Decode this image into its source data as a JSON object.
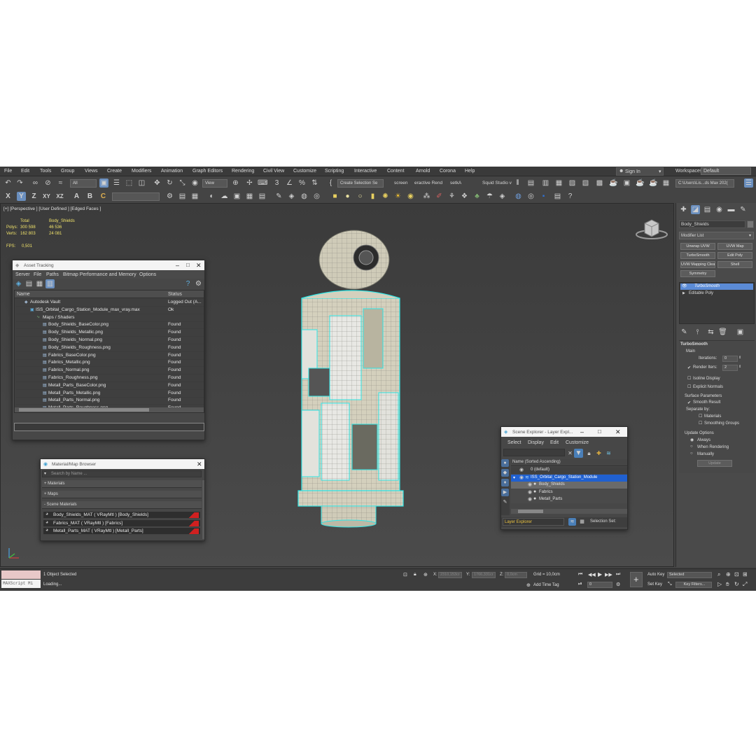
{
  "menu": [
    "File",
    "Edit",
    "Tools",
    "Group",
    "Views",
    "Create",
    "Modifiers",
    "Animation",
    "Graph Editors",
    "Rendering",
    "Civil View",
    "Customize",
    "Scripting",
    "Interactive",
    "Content",
    "Arnold",
    "Corona",
    "Help"
  ],
  "signin": "Sign In",
  "workspaces": {
    "label": "Workspaces:",
    "value": "Default"
  },
  "toolbar": {
    "filter": "All",
    "view": "View",
    "selection_set": "Create Selection Se",
    "screen": "screen",
    "interactive": "eractive Rend",
    "setka": "setkA",
    "squid": "Squid Studio v",
    "path": "C:\\Users\\Lis...ds Max 202("
  },
  "viewport": {
    "label": "[+] [Perspective ] [User Defined ] [Edged Faces ]",
    "stats": {
      "total": "Total",
      "object": "Body_Shields",
      "polys_label": "Polys:",
      "polys_total": "300 598",
      "polys_obj": "46 536",
      "verts_label": "Verts:",
      "verts_total": "162 803",
      "verts_obj": "24 081",
      "fps_label": "FPS:",
      "fps": "0,501"
    }
  },
  "asset_tracking": {
    "title": "Asset Tracking",
    "menu": [
      "Server",
      "File",
      "Paths",
      "Bitmap Performance and Memory",
      "Options"
    ],
    "col_name": "Name",
    "col_status": "Status",
    "rows": [
      {
        "name": "Autodesk Vault",
        "status": "Logged Out (A..."
      },
      {
        "name": "ISS_Orbital_Cargo_Station_Module_max_vray.max",
        "status": "Ok"
      },
      {
        "name": "Maps / Shaders",
        "status": ""
      },
      {
        "name": "Body_Shields_BaseColor.png",
        "status": "Found"
      },
      {
        "name": "Body_Shields_Metallic.png",
        "status": "Found"
      },
      {
        "name": "Body_Shields_Normal.png",
        "status": "Found"
      },
      {
        "name": "Body_Shields_Roughness.png",
        "status": "Found"
      },
      {
        "name": "Fabrics_BaseColor.png",
        "status": "Found"
      },
      {
        "name": "Fabrics_Metallic.png",
        "status": "Found"
      },
      {
        "name": "Fabrics_Normal.png",
        "status": "Found"
      },
      {
        "name": "Fabrics_Roughness.png",
        "status": "Found"
      },
      {
        "name": "Metall_Parts_BaseColor.png",
        "status": "Found"
      },
      {
        "name": "Metall_Parts_Metallic.png",
        "status": "Found"
      },
      {
        "name": "Metall_Parts_Normal.png",
        "status": "Found"
      },
      {
        "name": "Metall_Parts_Roughness.png",
        "status": "Found"
      }
    ]
  },
  "material_browser": {
    "title": "Material/Map Browser",
    "search_placeholder": "Search by Name ...",
    "sections": [
      "+ Materials",
      "+ Maps",
      "- Scene Materials"
    ],
    "materials": [
      "Body_Shields_MAT ( VRayMtl ) [Body_Shields]",
      "Fabrics_MAT ( VRayMtl ) [Fabrics]",
      "Metall_Parts_MAT ( VRayMtl ) [Metall_Parts]"
    ]
  },
  "scene_explorer": {
    "title": "Scene Explorer - Layer Expl...",
    "menu": [
      "Select",
      "Display",
      "Edit",
      "Customize"
    ],
    "column": "Name (Sorted Ascending)",
    "rows": [
      {
        "name": "0 (default)",
        "level": 1
      },
      {
        "name": "ISS_Orbital_Cargo_Station_Module",
        "level": 1
      },
      {
        "name": "Body_Shields",
        "level": 2
      },
      {
        "name": "Fabrics",
        "level": 2
      },
      {
        "name": "Metall_Parts",
        "level": 2
      }
    ],
    "footer": "Layer Explorer",
    "selection_set": "Selection Set:"
  },
  "command_panel": {
    "object_name": "Body_Shields",
    "modifier_list": "Modifier List",
    "buttons": [
      "Unwrap UVW",
      "UVW Map",
      "TurboSmooth",
      "Edit Poly",
      "UVW Mapping Clear",
      "Shell",
      "Symmetry"
    ],
    "stack": [
      "TurboSmooth",
      "Editable Poly"
    ],
    "rollout_title": "TurboSmooth",
    "main": "Main",
    "iterations_label": "Iterations:",
    "iterations": "0",
    "render_iters_label": "Render Iters:",
    "render_iters": "2",
    "isoline": "Isoline Display",
    "explicit": "Explicit Normals",
    "surface": "Surface Parameters",
    "smooth_result": "Smooth Result",
    "separate": "Separate by:",
    "materials": "Materials",
    "smoothing_groups": "Smoothing Groups",
    "update_options": "Update Options",
    "always": "Always",
    "when_rendering": "When Rendering",
    "manually": "Manually",
    "update": "Update"
  },
  "statusbar": {
    "maxscript": "MAXScript Mi",
    "selected": "1 Object Selected",
    "loading": "Loading...",
    "x_label": "X:",
    "x": "2310,153cr",
    "y_label": "Y:",
    "y": "1766,331cr",
    "z_label": "Z:",
    "z": "0,0cm",
    "grid": "Grid = 10,0cm",
    "add_time_tag": "Add Time Tag",
    "frame": "0",
    "auto_key": "Auto Key",
    "selected_dd": "Selected",
    "set_key": "Set Key",
    "key_filters": "Key Filters..."
  }
}
